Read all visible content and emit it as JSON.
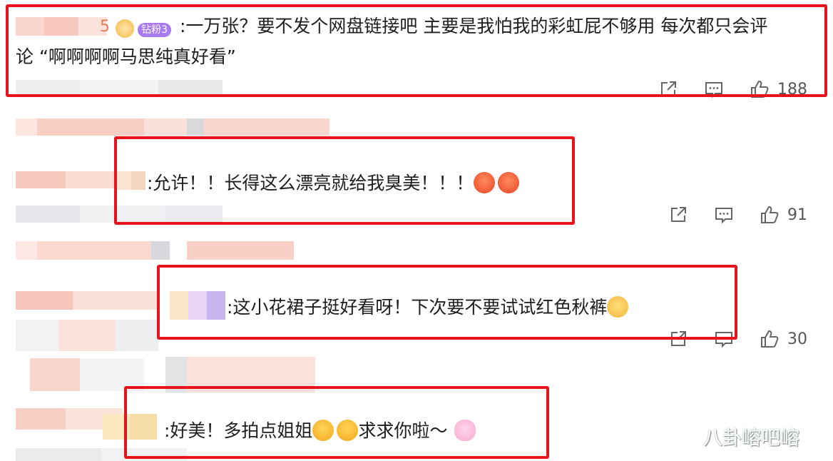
{
  "comments": [
    {
      "username_tail": "5",
      "badge": "钻粉3",
      "text_line1": ":一万张？要不发个网盘链接吧 主要是我怕我的彩虹屁不够用 每次都只会评",
      "text_line2": "论 “啊啊啊啊马思纯真好看”",
      "likes": "188"
    },
    {
      "text": ":允许！！长得这么漂亮就给我臭美！！！",
      "emojis": [
        "heart-eyes-emoji",
        "heart-eyes-emoji"
      ],
      "likes": "91"
    },
    {
      "text": ":这小花裙子挺好看呀！下次要不要试试红色秋裤",
      "emojis": [
        "cat-emoji"
      ],
      "likes": "30"
    },
    {
      "text_before": ":好美！多拍点姐姐",
      "text_after": "求求你啦～",
      "emojis": [
        "crying-emoji",
        "crying-emoji",
        "pig-emoji"
      ]
    }
  ],
  "watermark": "八卦嵱吧嵱",
  "colors": {
    "highlight": "#e8141c",
    "badge": "#a97bf0",
    "icon": "#555555"
  },
  "icons": [
    "share-icon",
    "comment-icon",
    "like-icon"
  ]
}
